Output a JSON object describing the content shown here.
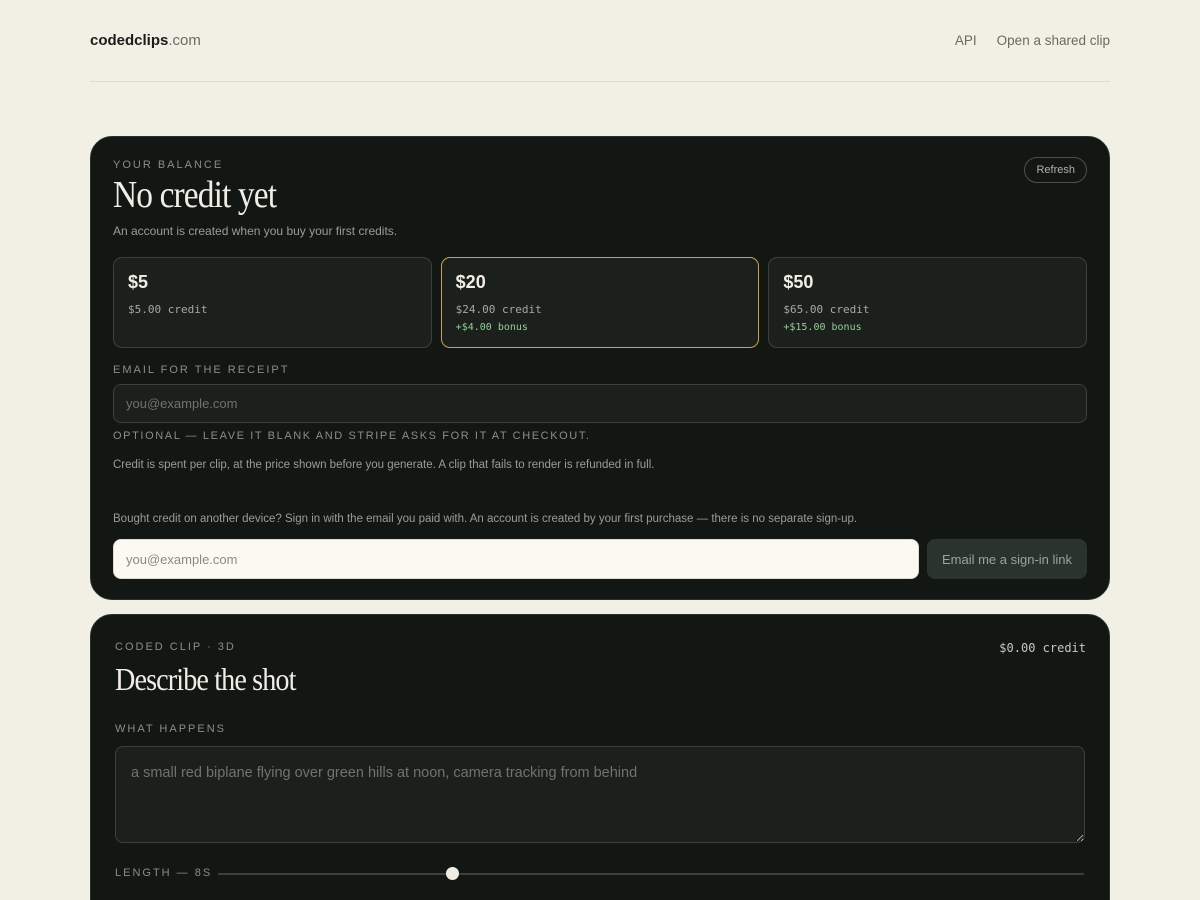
{
  "header": {
    "logo_main": "codedclips",
    "logo_tld": ".com",
    "nav": [
      "API",
      "Open a shared clip"
    ]
  },
  "balance": {
    "eyebrow": "YOUR BALANCE",
    "title": "No credit yet",
    "subtitle": "An account is created when you buy your first credits.",
    "refresh_label": "Refresh",
    "plans": [
      {
        "price": "$5",
        "credit": "$5.00 credit",
        "bonus": "",
        "selected": false
      },
      {
        "price": "$20",
        "credit": "$24.00 credit",
        "bonus": "+$4.00 bonus",
        "selected": true
      },
      {
        "price": "$50",
        "credit": "$65.00 credit",
        "bonus": "+$15.00 bonus",
        "selected": false
      }
    ],
    "email_label": "EMAIL FOR THE RECEIPT",
    "email_placeholder": "you@example.com",
    "email_hint": "OPTIONAL — LEAVE IT BLANK AND STRIPE ASKS FOR IT AT CHECKOUT.",
    "policy": "Credit is spent per clip, at the price shown before you generate. A clip that fails to render is refunded in full.",
    "signin_text": "Bought credit on another device? Sign in with the email you paid with. An account is created by your first purchase — there is no separate sign-up.",
    "signin_placeholder": "you@example.com",
    "signin_button": "Email me a sign-in link"
  },
  "clip": {
    "eyebrow": "CODED CLIP · 3D",
    "credit": "$0.00 credit",
    "title": "Describe the shot",
    "what_label": "WHAT HAPPENS",
    "what_placeholder": "a small red biplane flying over green hills at noon, camera tracking from behind",
    "length_label": "LENGTH — 8S",
    "length_fraction": 0.27
  },
  "colors": {
    "page_bg": "#f2efe5",
    "card_bg": "#121714",
    "selected_border": "#c9a24c",
    "bonus_green": "#8fd18f"
  }
}
